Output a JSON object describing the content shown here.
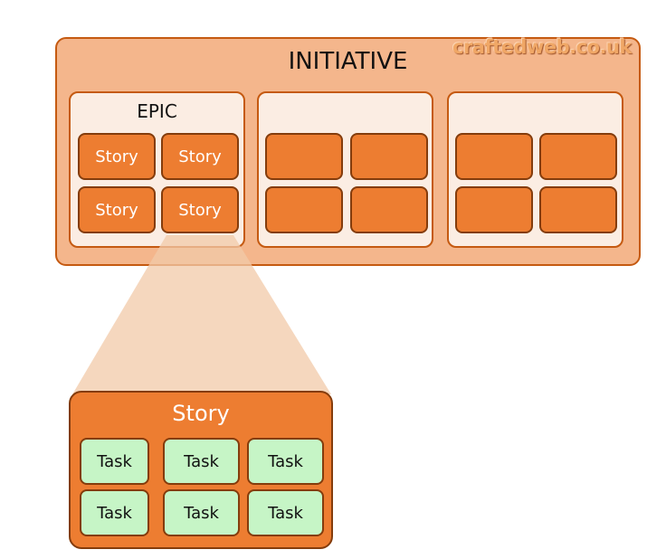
{
  "watermark": "craftedweb.co.uk",
  "initiative": {
    "title": "INITIATIVE",
    "epics": [
      {
        "title": "EPIC",
        "stories": [
          "Story",
          "Story",
          "Story",
          "Story"
        ]
      },
      {
        "title": "",
        "stories": [
          "",
          "",
          "",
          ""
        ]
      },
      {
        "title": "",
        "stories": [
          "",
          "",
          "",
          ""
        ]
      }
    ]
  },
  "story_detail": {
    "title": "Story",
    "tasks": [
      "Task",
      "Task",
      "Task",
      "Task",
      "Task",
      "Task"
    ]
  },
  "colors": {
    "initiative_fill": "#F4B68C",
    "border_orange": "#C55A11",
    "epic_fill": "#FBEDE3",
    "story_fill": "#ED7D31",
    "story_border": "#843C0C",
    "task_fill": "#C6F5C6",
    "funnel_fill": "#F2C9A8"
  }
}
